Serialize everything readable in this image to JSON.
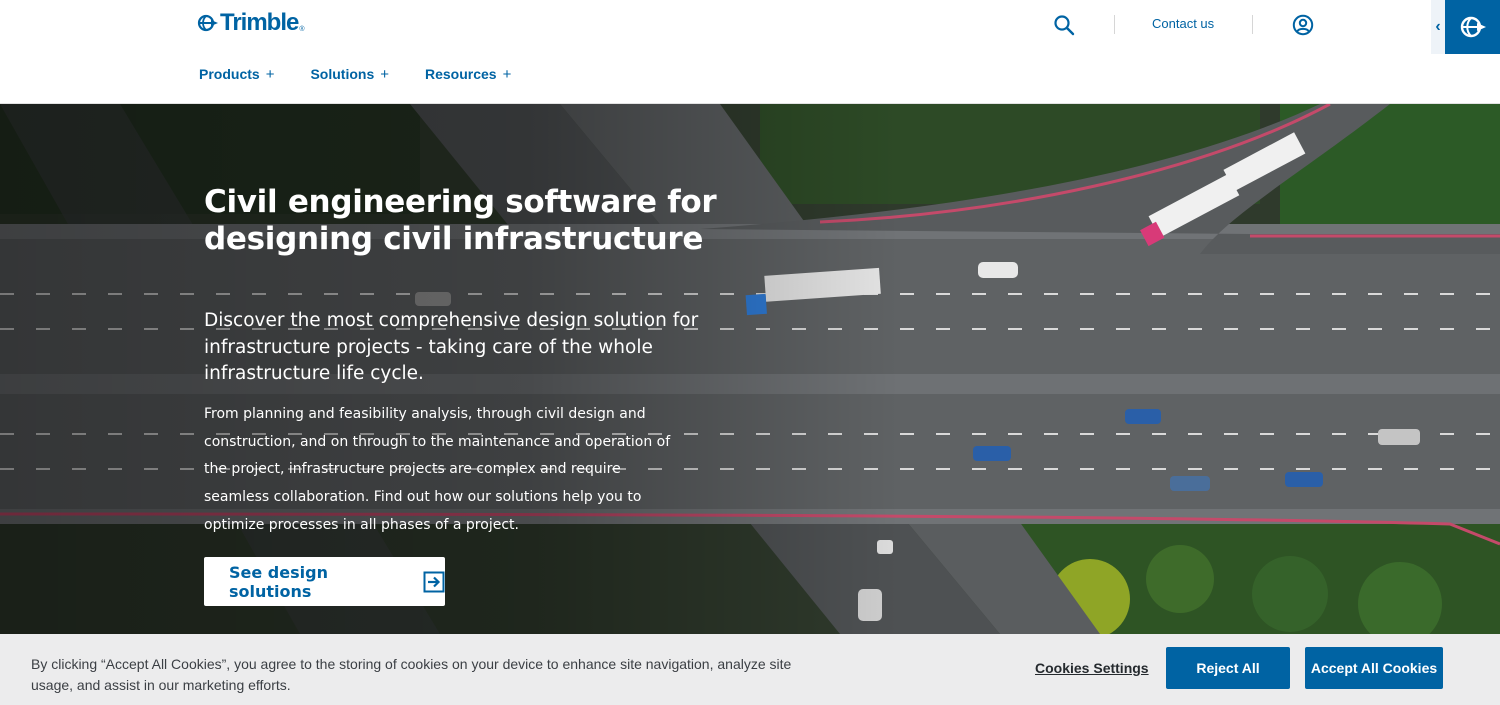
{
  "header": {
    "logo_text": "Trimble",
    "logo_mark": "®",
    "contact_label": "Contact us",
    "nav": [
      {
        "label": "Products",
        "icon": "+"
      },
      {
        "label": "Solutions",
        "icon": "+"
      },
      {
        "label": "Resources",
        "icon": "+"
      }
    ],
    "side_tab_chevron": "‹",
    "icons": {
      "search": "search-icon",
      "account": "account-icon",
      "emblem": "trimble-emblem-icon"
    }
  },
  "hero": {
    "title": "Civil engineering software for designing civil infrastructure",
    "subtitle": "Discover the most comprehensive design solution for infrastructure projects - taking care of the whole infrastructure life cycle.",
    "body": "From planning and feasibility analysis, through civil design and construction, and on through to the maintenance and operation of the project, infrastructure projects are complex and require seamless collaboration. Find out how our solutions help you to optimize processes in all phases of a project.",
    "cta_label": "See design solutions",
    "background": "aerial view of highway interchange with trucks and cars"
  },
  "cookie_banner": {
    "text": "By clicking “Accept All Cookies”, you agree to the storing of cookies on your device to enhance site navigation, analyze site usage, and assist in our marketing efforts.",
    "settings_label": "Cookies Settings",
    "reject_label": "Reject All",
    "accept_label": "Accept All Cookies"
  },
  "colors": {
    "brand_blue": "#0063a3",
    "cookie_bg": "#ececed",
    "text_dark": "#252a2e"
  }
}
